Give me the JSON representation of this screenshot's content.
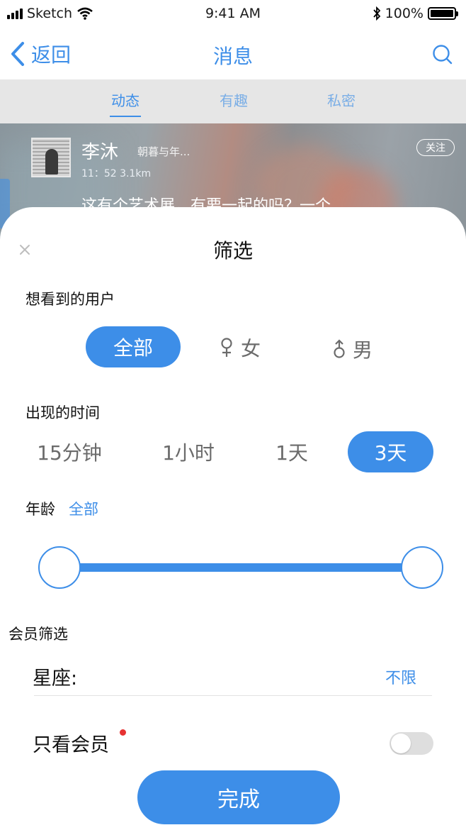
{
  "status": {
    "carrier": "Sketch",
    "time": "9:41 AM",
    "battery": "100%"
  },
  "nav": {
    "back_label": "返回",
    "title": "消息"
  },
  "tabs": [
    {
      "label": "动态",
      "active": true
    },
    {
      "label": "有趣",
      "active": false
    },
    {
      "label": "私密",
      "active": false
    }
  ],
  "feed": {
    "user_name": "李沐",
    "user_sub": "朝暮与年...",
    "meta": "11：52   3.1km",
    "follow_label": "关注",
    "post_text": "这有个艺术展，有要一起的吗？一个........"
  },
  "filter": {
    "title": "筛选",
    "users_label": "想看到的用户",
    "gender_options": [
      {
        "label": "全部",
        "selected": true
      },
      {
        "label": "女",
        "icon": "female-icon",
        "selected": false
      },
      {
        "label": "男",
        "icon": "male-icon",
        "selected": false
      }
    ],
    "time_label": "出现的时间",
    "time_options": [
      {
        "label": "15分钟",
        "selected": false
      },
      {
        "label": "1小时",
        "selected": false
      },
      {
        "label": "1天",
        "selected": false
      },
      {
        "label": "3天",
        "selected": true
      }
    ],
    "age_label": "年龄",
    "age_value": "全部",
    "age_range": [
      0,
      1
    ],
    "member_label": "会员筛选",
    "zodiac_label": "星座:",
    "zodiac_value": "不限",
    "vip_only_label": "只看会员",
    "vip_only_enabled": false,
    "done_label": "完成"
  },
  "colors": {
    "accent": "#3d8ee8",
    "tab_bg": "#e6e6e6",
    "badge_red": "#e63232"
  }
}
